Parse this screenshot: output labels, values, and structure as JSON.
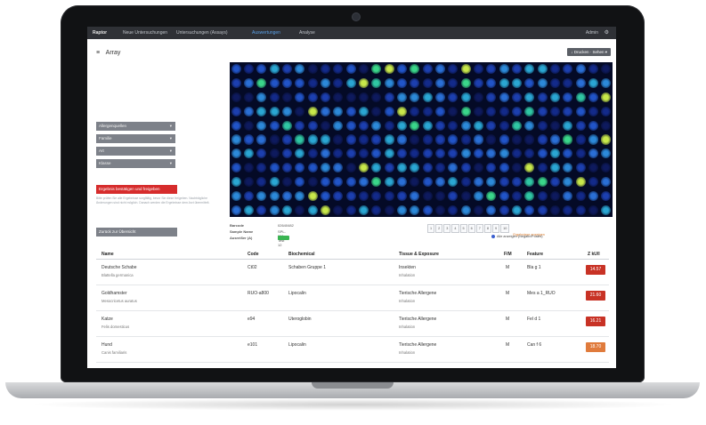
{
  "app": {
    "brand": "Raptor",
    "nav": [
      "Neue Untersuchungen",
      "Untersuchungen (Assays)",
      "Auswertungen",
      "Analyse"
    ],
    "user": "Admin",
    "gear": "⚙"
  },
  "page": {
    "title": "Array",
    "menu_icon": "≡",
    "top_button": "↓ Drucken · Sehen ▾"
  },
  "sidebar": {
    "filters": [
      {
        "label": "Allergenquellen",
        "chev": "▾"
      },
      {
        "label": "Familie",
        "chev": "▾"
      },
      {
        "label": "Art",
        "chev": "▾"
      },
      {
        "label": "Klasse",
        "chev": "▾"
      }
    ],
    "red_button": "Ergebnis bestätigen und freigeben",
    "note": "Bitte prüfen Sie alle Ergebnisse sorgfältig, bevor Sie diese freigeben. Nachträgliche Änderungen sind nicht möglich. Danach werden die Ergebnisse dem Arzt übermittelt.",
    "bottom_button": "Zurück zur Übersicht"
  },
  "meta": {
    "labels": [
      "Barcode",
      "Sample Name",
      "Ausreißer (A)"
    ],
    "values": [
      "02640482",
      "SPL-001 Test 12",
      ""
    ]
  },
  "pager": {
    "buttons": [
      "1",
      "2",
      "3",
      "4",
      "5",
      "6",
      "7",
      "8",
      "9",
      "10"
    ],
    "text": "Ergebnisse anzeigen"
  },
  "radio_label": "Alle anzeigen (Negativ/Positiv)",
  "table": {
    "headers": [
      "Name",
      "Code",
      "Biochemical",
      "Tissue & Exposure",
      "F/M",
      "Feature",
      "Z kU/l"
    ],
    "rows": [
      {
        "name": "Deutsche Schabe",
        "latin": "Blattella germanica",
        "code": "Ct02",
        "biochem": "Schaben Gruppe 1",
        "tissue": "Insekten",
        "exposure": "Inhalation",
        "fm": "M",
        "feature": "Bla g 1",
        "value": "14.57",
        "color": "#c83225"
      },
      {
        "name": "Goldhamster",
        "latin": "Mesocricetus auratus",
        "code": "RUO-a800",
        "biochem": "Lipocalin",
        "tissue": "Tierische Allergene",
        "exposure": "Inhalation",
        "fm": "M",
        "feature": "Mes a 1_RUO",
        "value": "21.60",
        "color": "#c83225"
      },
      {
        "name": "Katze",
        "latin": "Felis domesticus",
        "code": "e94",
        "biochem": "Uteroglobin",
        "tissue": "Tierische Allergene",
        "exposure": "Inhalation",
        "fm": "M",
        "feature": "Fel d 1",
        "value": "16.21",
        "color": "#c83225"
      },
      {
        "name": "Hund",
        "latin": "Canis familiaris",
        "code": "e101",
        "biochem": "Lipocalin",
        "tissue": "Tierische Allergene",
        "exposure": "Inhalation",
        "fm": "M",
        "feature": "Can f 6",
        "value": "18.70",
        "color": "#e07b3c"
      }
    ]
  }
}
